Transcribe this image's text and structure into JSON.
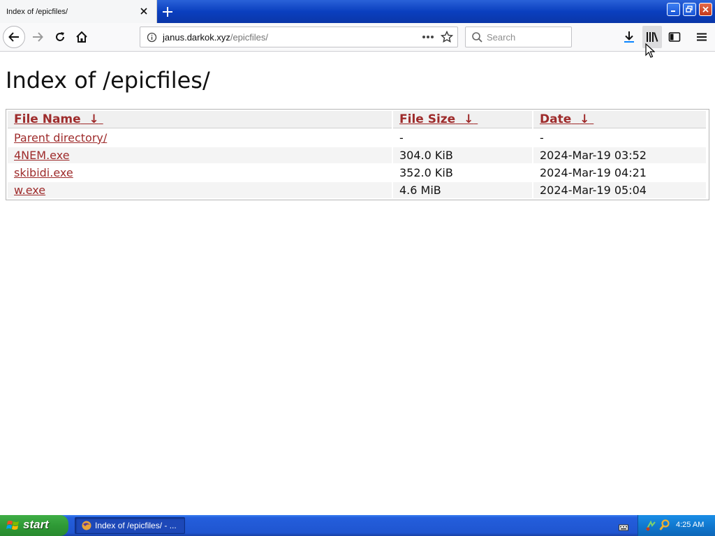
{
  "browser": {
    "tab_title": "Index of /epicfiles/",
    "url_host": "janus.darkok.xyz",
    "url_path": "/epicfiles/",
    "search_placeholder": "Search"
  },
  "page": {
    "heading": "Index of /epicfiles/",
    "columns": [
      {
        "label": "File Name",
        "sort_icon": "↓"
      },
      {
        "label": "File Size",
        "sort_icon": "↓"
      },
      {
        "label": "Date",
        "sort_icon": "↓"
      }
    ],
    "rows": [
      {
        "name": "Parent directory/",
        "size": "-",
        "date": "-"
      },
      {
        "name": "4NEM.exe",
        "size": "304.0 KiB",
        "date": "2024-Mar-19 03:52"
      },
      {
        "name": "skibidi.exe",
        "size": "352.0 KiB",
        "date": "2024-Mar-19 04:21"
      },
      {
        "name": "w.exe",
        "size": "4.6 MiB",
        "date": "2024-Mar-19 05:04"
      }
    ]
  },
  "taskbar": {
    "start_label": "start",
    "window_label": "Index of /epicfiles/ - ...",
    "clock": "4:25 AM"
  },
  "colors": {
    "link": "#9e2b2b",
    "titlebar": "#0a3fbf",
    "start_green": "#2f9a36"
  }
}
